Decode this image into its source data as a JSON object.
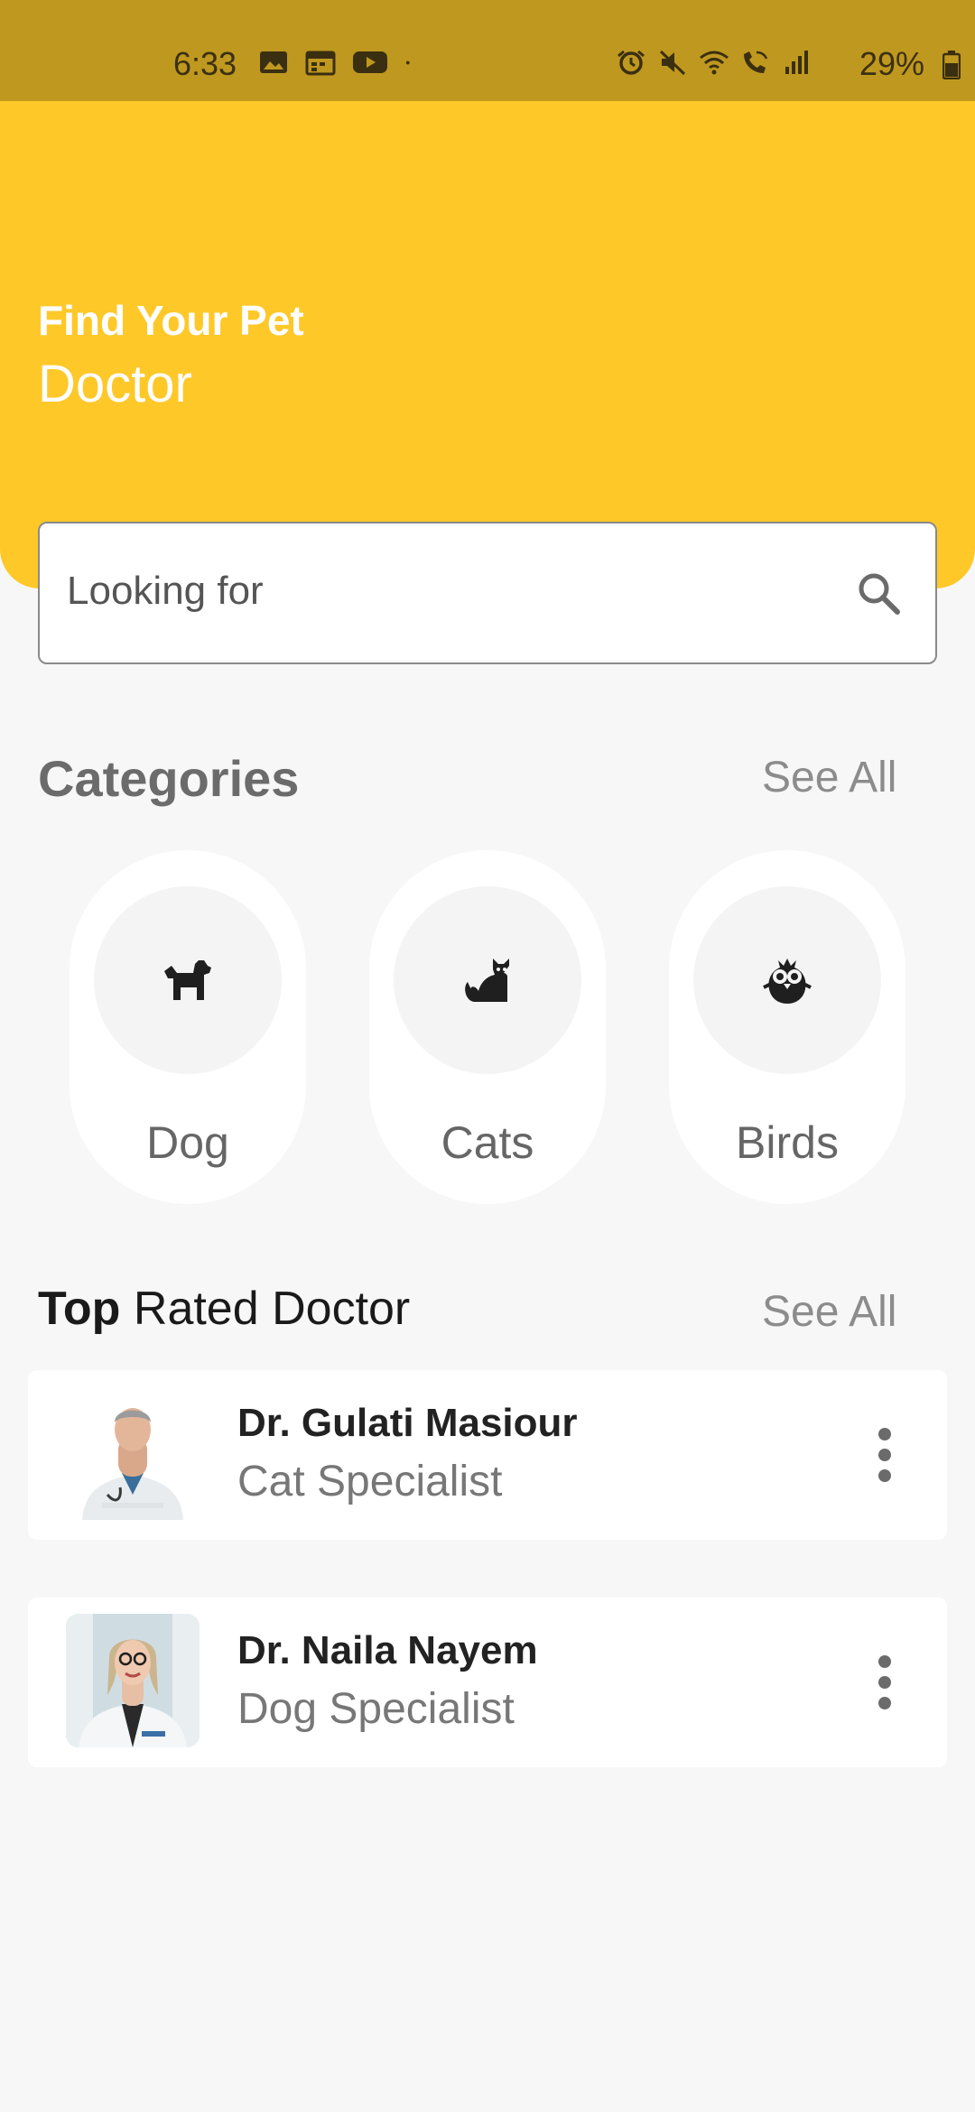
{
  "status_bar": {
    "time": "6:33",
    "battery": "29%",
    "left_icons": [
      "gallery-icon",
      "calendar-icon",
      "youtube-icon",
      "dot-icon"
    ],
    "right_icons": [
      "alarm-icon",
      "mute-icon",
      "wifi-icon",
      "wifi-calling-icon",
      "signal-icon",
      "battery-icon"
    ]
  },
  "hero": {
    "title": "Find Your Pet",
    "subtitle": "Doctor",
    "color": "#fec829"
  },
  "search": {
    "placeholder": "Looking for",
    "icon": "search-icon"
  },
  "categories": {
    "title": "Categories",
    "see_all": "See All",
    "items": [
      {
        "label": "Dog",
        "icon": "dog-icon"
      },
      {
        "label": "Cats",
        "icon": "cat-icon"
      },
      {
        "label": "Birds",
        "icon": "bird-icon"
      }
    ]
  },
  "top_rated": {
    "title_bold": "Top",
    "title_rest": " Rated Doctor",
    "see_all": "See All",
    "doctors": [
      {
        "name": "Dr. Gulati Masiour",
        "specialty": "Cat Specialist"
      },
      {
        "name": "Dr. Naila Nayem",
        "specialty": "Dog Specialist"
      }
    ]
  }
}
